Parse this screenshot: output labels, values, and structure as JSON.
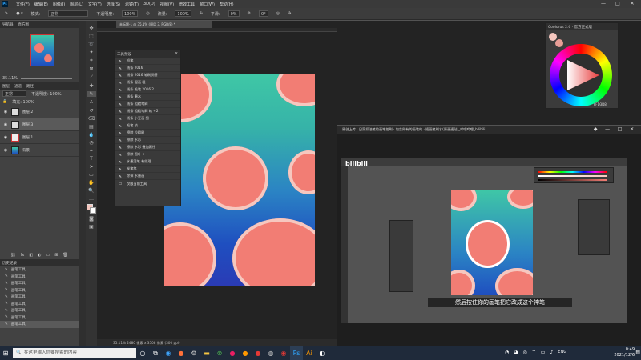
{
  "menubar": {
    "app_badge": "Ps",
    "items": [
      "文件(F)",
      "编辑(E)",
      "图像(I)",
      "图层(L)",
      "文字(Y)",
      "选择(S)",
      "滤镜(T)",
      "3D(D)",
      "视图(V)",
      "增效工具",
      "窗口(W)",
      "帮助(H)"
    ],
    "minimize": "—",
    "maximize": "□",
    "close": "✕"
  },
  "options_bar": {
    "mode_label": "模式:",
    "mode_value": "正常",
    "opacity_label": "不透明度:",
    "opacity_value": "100%",
    "flow_label": "流量:",
    "flow_value": "100%",
    "smoothing_label": "平滑:",
    "smoothing_value": "0%",
    "angle_value": "0°"
  },
  "left_panel": {
    "navigator_tabs": [
      "导航器",
      "直方图"
    ],
    "zoom": "35.11%",
    "layers_tabs": [
      "图层",
      "通道",
      "路径"
    ],
    "blend": "正常",
    "opacity": "不透明度: 100%",
    "fill": "填充: 100%",
    "layers": [
      {
        "name": "图层 2",
        "selected": false
      },
      {
        "name": "图层 3",
        "selected": true
      },
      {
        "name": "图层 1",
        "selected": false
      },
      {
        "name": "背景",
        "selected": false
      }
    ],
    "history_tab": "历史记录",
    "history_items": [
      "画笔工具",
      "画笔工具",
      "画笔工具",
      "画笔工具",
      "画笔工具",
      "画笔工具",
      "画笔工具",
      "画笔工具",
      "画笔工具"
    ]
  },
  "doc_tab": "未标题-1 @ 35.1% (图层 3, RGB/8) *",
  "brush_panel": {
    "title": "工具预设",
    "items": [
      "铅笔",
      "线条 2016",
      "线条 2016 笔刷质感",
      "线条 湿画 粗",
      "线条 毛笔 2016.2",
      "线条 墨水",
      "线条 粗糙笔刷",
      "线条 粗糙笔刷 缩 +2",
      "线条 小豆画 细",
      "毛笔 淡",
      "擦除 粒粗刷",
      "擦除 水彩",
      "擦除 水彩 叠加属性",
      "擦除 图叶 +",
      "水墨湿笔 有纹理",
      "炭笔笔",
      "涂抹 水墨画"
    ],
    "footer": "仅限当前工具"
  },
  "color_widget": {
    "title": "Coolorus 2.6 · 官方正式版",
    "hex": "FFD3D8"
  },
  "video": {
    "title": "原创上传 | 日家扣油笔的画笔控刷 · 包含所有的画笔的 · 插画笔刷水(原画速贴)_哔哩哔哩_bilibili",
    "watermark": "bilibili",
    "subtitle": "然后按住你的画笔把它改成这个神笔"
  },
  "status": "35.11%   2480 像素 x 3508 像素 (300 ppi)",
  "taskbar": {
    "search_placeholder": "在这里输入你要搜索的内容",
    "lang": "ENG",
    "time": "0:49",
    "date": "2021/12/6"
  },
  "colors": {
    "accent": "#31a8ff",
    "blob": "#f27d74",
    "blob_rim": "#f6c7bf"
  }
}
